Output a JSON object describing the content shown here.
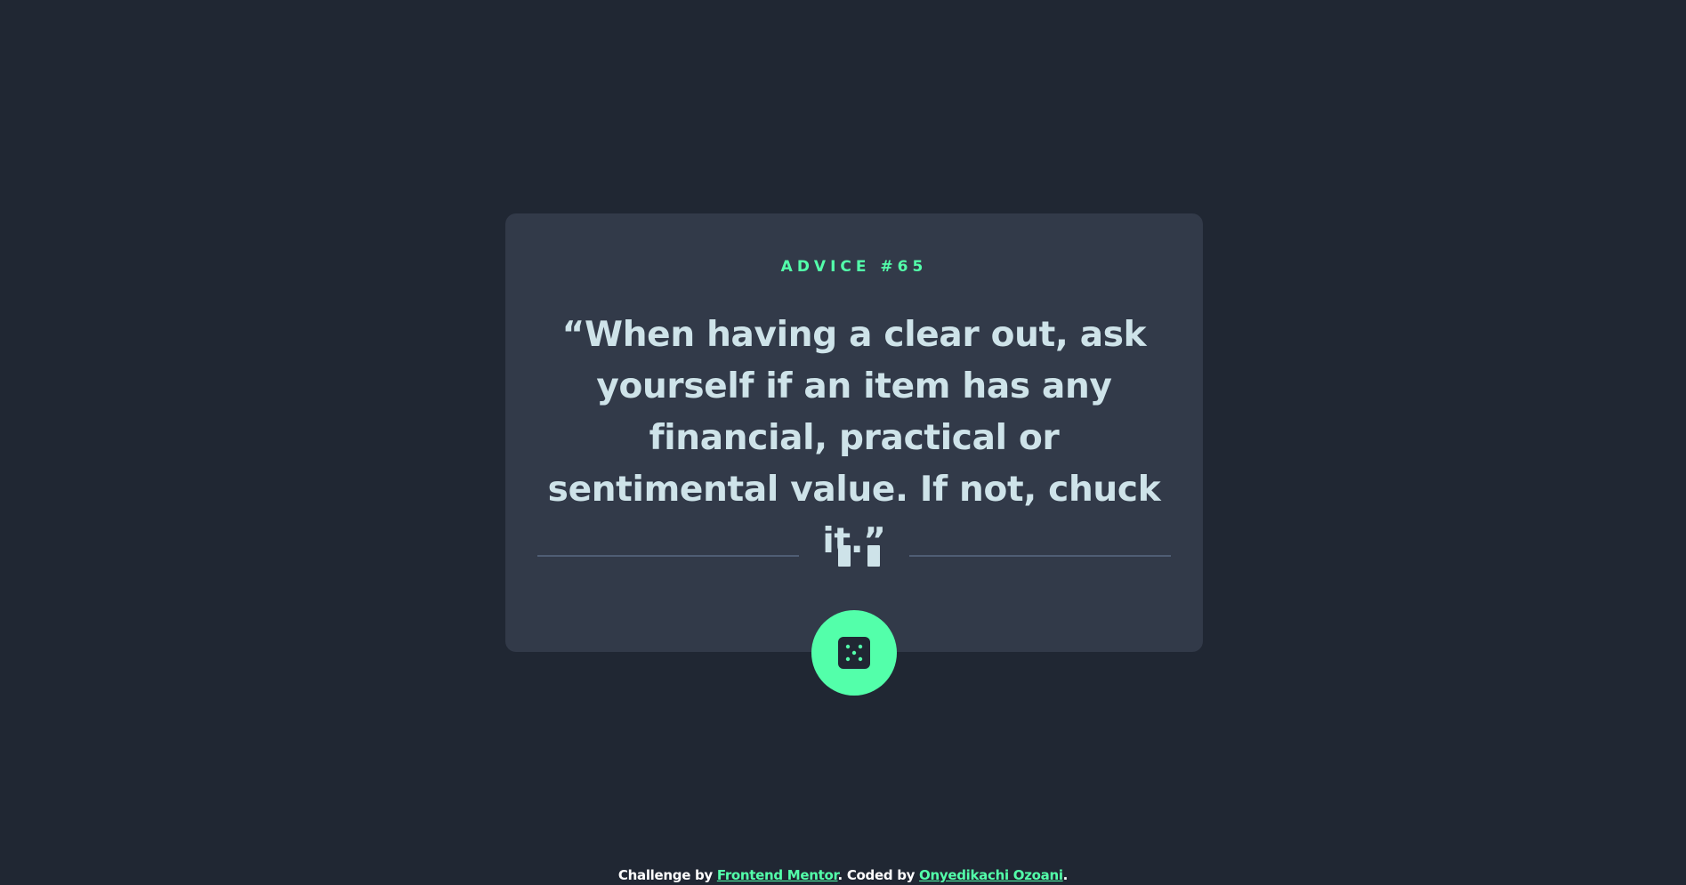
{
  "advice": {
    "label": "ADVICE #65",
    "quote": "“When having a clear out, ask yourself if an item has any financial, practical or sentimental value. If not, chuck it.”"
  },
  "icons": {
    "divider": "pause-icon",
    "generate_button": "dice-icon"
  },
  "footer": {
    "prefix": "Challenge by ",
    "challenge_link": "Frontend Mentor",
    "middle": ". Coded by ",
    "author_link": "Onyedikachi Ozoani",
    "suffix": "."
  },
  "colors": {
    "background": "#202733",
    "card": "#323a49",
    "accent": "#53ffaa",
    "text": "#cee3e9",
    "divider": "#4f5d74"
  }
}
